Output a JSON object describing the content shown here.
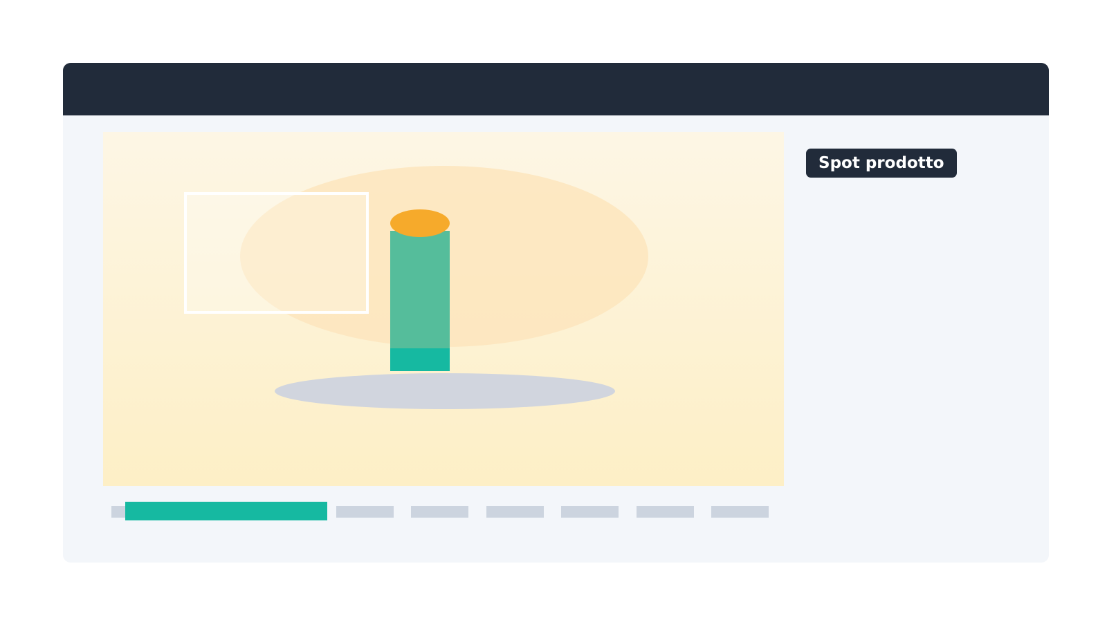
{
  "panel": {
    "badge_label": "Spot prodotto"
  },
  "colors": {
    "title_bar": "#212b3a",
    "panel_background": "#f3f6fa",
    "canvas_top": "#fdf6e5",
    "canvas_bottom": "#fdefc6",
    "product_body": "#55bd9b",
    "product_base": "#16b9a1",
    "product_cap": "#f6aa2b",
    "spotlight": "#fde5bd",
    "shadow": "#d1d5de",
    "timeline_active": "#16b9a1",
    "timeline_inactive": "#ccd4df"
  },
  "timeline": {
    "segment_count": 7
  }
}
